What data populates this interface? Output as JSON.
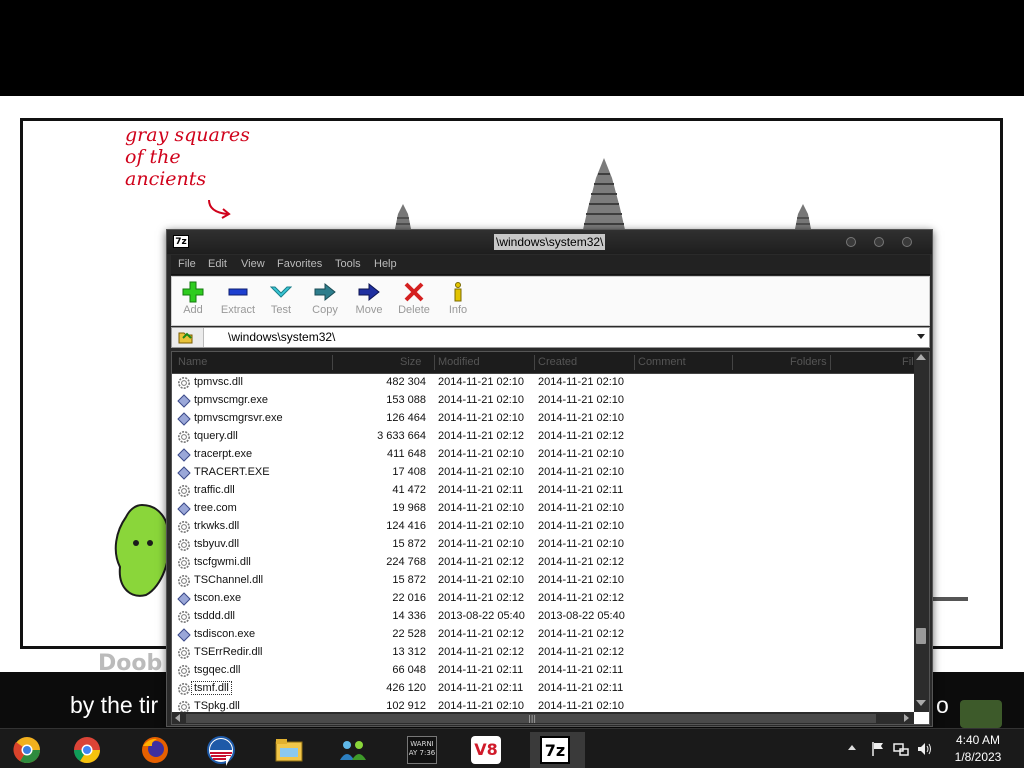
{
  "background": {
    "handwritten_note": "gray squares\nof the\nancients",
    "comic_text_partial": "Doob",
    "subtitle_left": "by the tir",
    "subtitle_right": "o"
  },
  "window": {
    "title": "\\windows\\system32\\",
    "app_icon_text": "7z",
    "menu": [
      "File",
      "Edit",
      "View",
      "Favorites",
      "Tools",
      "Help"
    ],
    "toolbar": [
      {
        "label": "Add",
        "icon": "add-icon"
      },
      {
        "label": "Extract",
        "icon": "extract-icon"
      },
      {
        "label": "Test",
        "icon": "test-icon"
      },
      {
        "label": "Copy",
        "icon": "copy-icon"
      },
      {
        "label": "Move",
        "icon": "move-icon"
      },
      {
        "label": "Delete",
        "icon": "delete-icon"
      },
      {
        "label": "Info",
        "icon": "info-icon"
      }
    ],
    "address": "\\windows\\system32\\",
    "columns": [
      "Name",
      "Size",
      "Modified",
      "Created",
      "Comment",
      "Folders",
      "Fil"
    ],
    "files": [
      {
        "name": "tpmvsc.dll",
        "size": "482 304",
        "modified": "2014-11-21 02:10",
        "created": "2014-11-21 02:10",
        "type": "dll"
      },
      {
        "name": "tpmvscmgr.exe",
        "size": "153 088",
        "modified": "2014-11-21 02:10",
        "created": "2014-11-21 02:10",
        "type": "exe"
      },
      {
        "name": "tpmvscmgrsvr.exe",
        "size": "126 464",
        "modified": "2014-11-21 02:10",
        "created": "2014-11-21 02:10",
        "type": "exe"
      },
      {
        "name": "tquery.dll",
        "size": "3 633 664",
        "modified": "2014-11-21 02:12",
        "created": "2014-11-21 02:12",
        "type": "dll"
      },
      {
        "name": "tracerpt.exe",
        "size": "411 648",
        "modified": "2014-11-21 02:10",
        "created": "2014-11-21 02:10",
        "type": "exe"
      },
      {
        "name": "TRACERT.EXE",
        "size": "17 408",
        "modified": "2014-11-21 02:10",
        "created": "2014-11-21 02:10",
        "type": "exe"
      },
      {
        "name": "traffic.dll",
        "size": "41 472",
        "modified": "2014-11-21 02:11",
        "created": "2014-11-21 02:11",
        "type": "dll"
      },
      {
        "name": "tree.com",
        "size": "19 968",
        "modified": "2014-11-21 02:10",
        "created": "2014-11-21 02:10",
        "type": "exe"
      },
      {
        "name": "trkwks.dll",
        "size": "124 416",
        "modified": "2014-11-21 02:10",
        "created": "2014-11-21 02:10",
        "type": "dll"
      },
      {
        "name": "tsbyuv.dll",
        "size": "15 872",
        "modified": "2014-11-21 02:10",
        "created": "2014-11-21 02:10",
        "type": "dll"
      },
      {
        "name": "tscfgwmi.dll",
        "size": "224 768",
        "modified": "2014-11-21 02:12",
        "created": "2014-11-21 02:12",
        "type": "dll"
      },
      {
        "name": "TSChannel.dll",
        "size": "15 872",
        "modified": "2014-11-21 02:10",
        "created": "2014-11-21 02:10",
        "type": "dll"
      },
      {
        "name": "tscon.exe",
        "size": "22 016",
        "modified": "2014-11-21 02:12",
        "created": "2014-11-21 02:12",
        "type": "exe"
      },
      {
        "name": "tsddd.dll",
        "size": "14 336",
        "modified": "2013-08-22 05:40",
        "created": "2013-08-22 05:40",
        "type": "dll"
      },
      {
        "name": "tsdiscon.exe",
        "size": "22 528",
        "modified": "2014-11-21 02:12",
        "created": "2014-11-21 02:12",
        "type": "exe"
      },
      {
        "name": "TSErrRedir.dll",
        "size": "13 312",
        "modified": "2014-11-21 02:12",
        "created": "2014-11-21 02:12",
        "type": "dll"
      },
      {
        "name": "tsgqec.dll",
        "size": "66 048",
        "modified": "2014-11-21 02:11",
        "created": "2014-11-21 02:11",
        "type": "dll"
      },
      {
        "name": "tsmf.dll",
        "size": "426 120",
        "modified": "2014-11-21 02:11",
        "created": "2014-11-21 02:11",
        "type": "dll",
        "focused": true
      },
      {
        "name": "TSpkg.dll",
        "size": "102 912",
        "modified": "2014-11-21 02:10",
        "created": "2014-11-21 02:10",
        "type": "dll"
      }
    ]
  },
  "taskbar": {
    "apps": [
      {
        "name": "chrome-canary-icon",
        "active": false
      },
      {
        "name": "chrome-icon",
        "active": false
      },
      {
        "name": "firefox-icon",
        "active": false
      },
      {
        "name": "obama-logo-icon",
        "active": false
      },
      {
        "name": "file-explorer-icon",
        "active": false
      },
      {
        "name": "network-people-icon",
        "active": false
      },
      {
        "name": "warning-app-icon",
        "active": false
      },
      {
        "name": "v8-icon",
        "active": false
      },
      {
        "name": "7zip-icon",
        "active": true
      }
    ],
    "warning_app_text": "WARNI\nAY 7:36",
    "v8_text": "V8",
    "sevenzip_text": "7z",
    "clock_time": "4:40 AM",
    "clock_date": "1/8/2023"
  },
  "colors": {
    "handwriting": "#d0021b",
    "titlebar": "#1e1e1e",
    "add": "#2ecc1f",
    "extract": "#1d3fd0",
    "test": "#39c7d6",
    "copy": "#2d7d8c",
    "move": "#1f2fa0",
    "delete": "#d42020",
    "info": "#e3c400"
  }
}
